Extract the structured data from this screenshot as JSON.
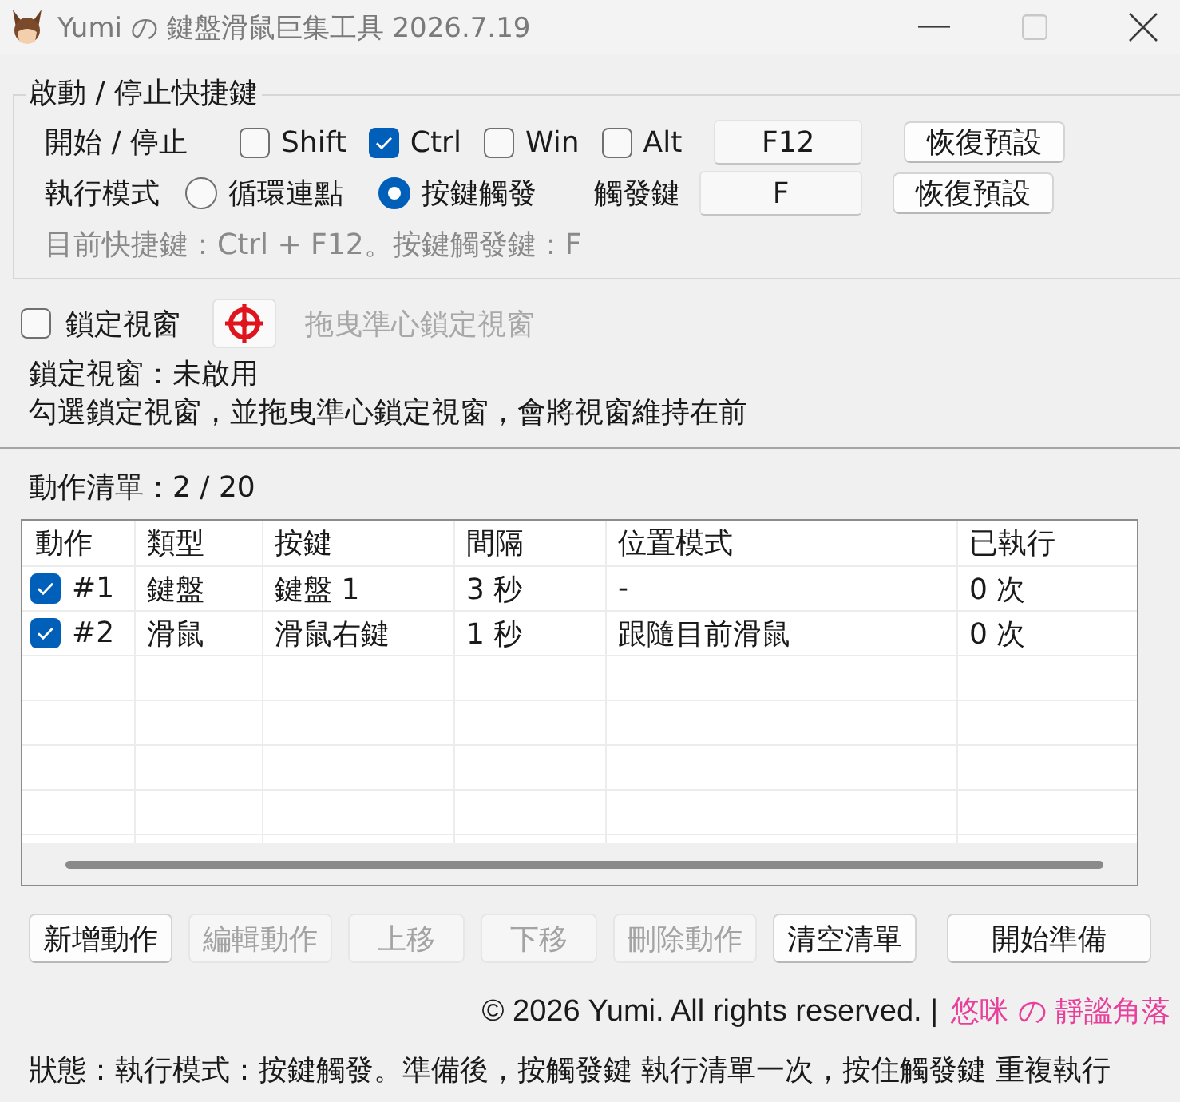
{
  "window": {
    "title": "Yumi の 鍵盤滑鼠巨集工具 2026.7.19",
    "controls": [
      {
        "kind": "minimize",
        "disabled": false
      },
      {
        "kind": "maximize",
        "disabled": true
      },
      {
        "kind": "close",
        "disabled": false
      }
    ]
  },
  "hotkey_group": {
    "title": "啟動 / 停止快捷鍵",
    "start_stop_row": {
      "label": "開始 / 停止",
      "modifiers": [
        {
          "label": "Shift",
          "checked": false
        },
        {
          "label": "Ctrl",
          "checked": true
        },
        {
          "label": "Win",
          "checked": false
        },
        {
          "label": "Alt",
          "checked": false
        }
      ],
      "key_field": {
        "value": "F12"
      },
      "reset_button": {
        "label": "恢復預設"
      }
    },
    "mode_row": {
      "label": "執行模式",
      "modes": [
        {
          "label": "循環連點",
          "selected": false
        },
        {
          "label": "按鍵觸發",
          "selected": true
        }
      ],
      "trigger_label": "觸發鍵",
      "trigger_field": {
        "value": "F"
      },
      "reset_button": {
        "label": "恢復預設"
      }
    },
    "summary": "目前快捷鍵：Ctrl + F12。按鍵觸發鍵：F"
  },
  "window_lock": {
    "checkbox": {
      "label": "鎖定視窗",
      "checked": false
    },
    "drag_label": {
      "label": "拖曳準心鎖定視窗",
      "disabled": true
    },
    "status": "鎖定視窗：未啟用",
    "description": "勾選鎖定視窗，並拖曳準心鎖定視窗，會將視窗維持在前"
  },
  "action_list": {
    "count": "動作清單：2 / 20",
    "table": {
      "columns": [
        "動作",
        "類型",
        "按鍵",
        "間隔",
        "位置模式",
        "已執行"
      ],
      "rows": [
        {
          "checked": true,
          "cells": [
            "#1",
            "鍵盤",
            "鍵盤 1",
            "3 秒",
            "-",
            "0 次"
          ]
        },
        {
          "checked": true,
          "cells": [
            "#2",
            "滑鼠",
            "滑鼠右鍵",
            "1 秒",
            "跟隨目前滑鼠",
            "0 次"
          ]
        }
      ]
    }
  },
  "buttons": [
    {
      "label": "新增動作",
      "disabled": false
    },
    {
      "label": "編輯動作",
      "disabled": true
    },
    {
      "label": "上移",
      "disabled": true
    },
    {
      "label": "下移",
      "disabled": true
    },
    {
      "label": "刪除動作",
      "disabled": true
    },
    {
      "label": "清空清單",
      "disabled": false
    },
    {
      "label": "開始準備",
      "disabled": false
    }
  ],
  "footer": {
    "copyright": "© 2026 Yumi. All rights reserved. |",
    "link": "悠咪 の 靜謐角落"
  },
  "status_bar": "狀態：執行模式：按鍵觸發。準備後，按觸發鍵 執行清單一次，按住觸發鍵 重複執行"
}
